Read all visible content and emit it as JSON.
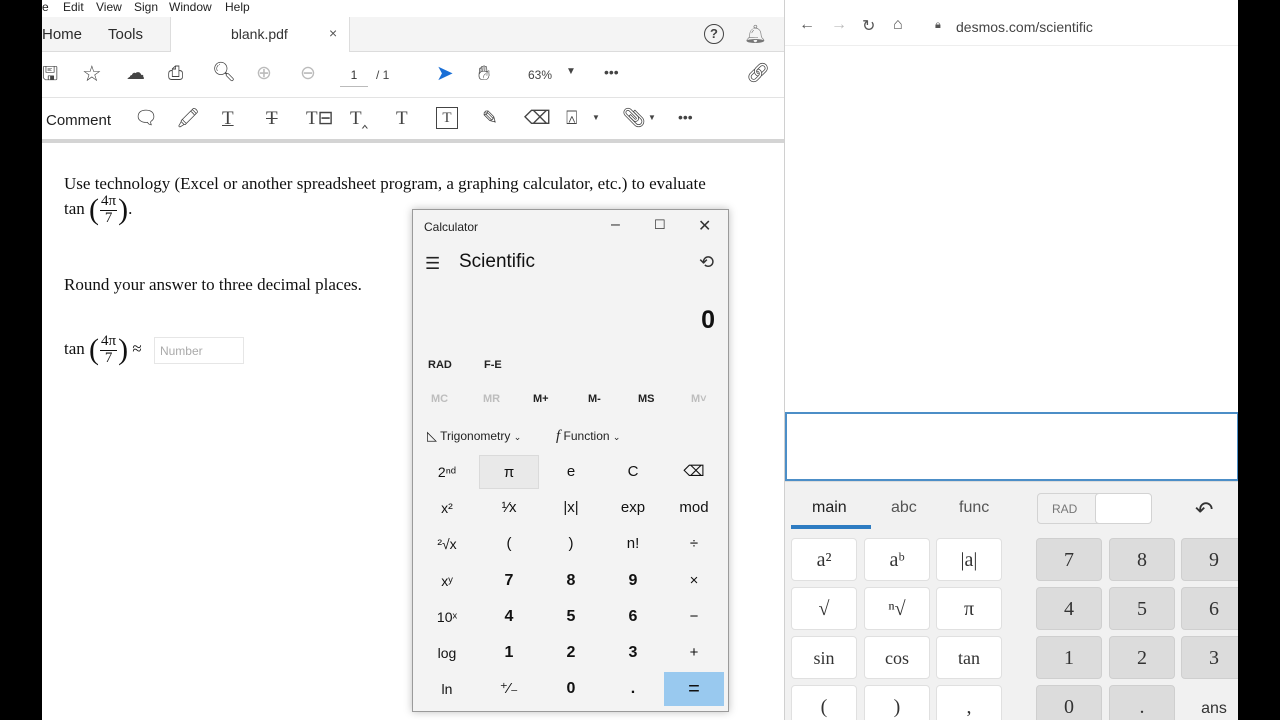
{
  "pdf": {
    "menu": [
      "e",
      "Edit",
      "View",
      "Sign",
      "Window",
      "Help"
    ],
    "tabs": {
      "home": "Home",
      "tools": "Tools",
      "doc": "blank.pdf",
      "close": "×"
    },
    "page": {
      "current": "1",
      "total": "/ 1"
    },
    "zoom": "63%",
    "comment_label": "Comment",
    "more": "•••",
    "content": {
      "line1": "Use technology (Excel or another spreadsheet program, a graphing calculator, etc.) to evaluate",
      "tan": "tan",
      "frac_num": "4π",
      "frac_den": "7",
      "period": ".",
      "line2": "Round your answer to three decimal places.",
      "approx": "≈",
      "input_placeholder": "Number"
    }
  },
  "calculator": {
    "title": "Calculator",
    "mode": "Scientific",
    "display": "0",
    "angle": "RAD",
    "fe": "F-E",
    "memory": [
      {
        "label": "MC",
        "enabled": false
      },
      {
        "label": "MR",
        "enabled": false
      },
      {
        "label": "M+",
        "enabled": true
      },
      {
        "label": "M-",
        "enabled": true
      },
      {
        "label": "MS",
        "enabled": true
      },
      {
        "label": "M˅",
        "enabled": false
      }
    ],
    "trig": "Trigonometry",
    "func": "Function",
    "keys": [
      [
        "2ⁿᵈ",
        "π",
        "e",
        "C",
        "⌫"
      ],
      [
        "x²",
        "¹⁄x",
        "|x|",
        "exp",
        "mod"
      ],
      [
        "²√x",
        "(",
        ")",
        "n!",
        "÷"
      ],
      [
        "xʸ",
        "7",
        "8",
        "9",
        "×"
      ],
      [
        "10ˣ",
        "4",
        "5",
        "6",
        "−"
      ],
      [
        "log",
        "1",
        "2",
        "3",
        "+"
      ],
      [
        "ln",
        "⁺⁄₋",
        "0",
        ".",
        "="
      ]
    ]
  },
  "browser": {
    "url": "desmos.com/scientific",
    "tabs": [
      "main",
      "abc",
      "func"
    ],
    "rad": "RAD",
    "left_keys": [
      [
        "a²",
        "aᵇ",
        "|a|"
      ],
      [
        "√",
        "ⁿ√",
        "π"
      ],
      [
        "sin",
        "cos",
        "tan"
      ],
      [
        "(",
        ")",
        ","
      ]
    ],
    "num_keys": [
      [
        "7",
        "8",
        "9"
      ],
      [
        "4",
        "5",
        "6"
      ],
      [
        "1",
        "2",
        "3"
      ],
      [
        "0",
        ".",
        "ans"
      ]
    ]
  }
}
